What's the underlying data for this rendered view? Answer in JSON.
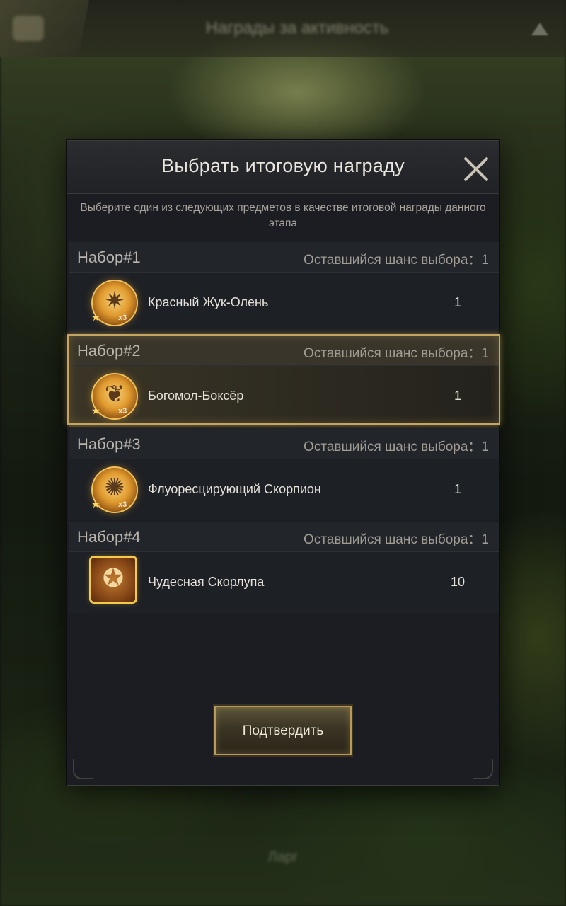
{
  "background": {
    "top_title": "Награды за активность",
    "bottom_text": "Ларг"
  },
  "modal": {
    "title": "Выбрать итоговую награду",
    "subtitle": "Выберите один из следующих предметов в качестве итоговой награды данного этапа",
    "confirm_label": "Подтвердить"
  },
  "sets": [
    {
      "name": "Набор#1",
      "chance_label": "Оставшийся шанс выбора：1",
      "item": {
        "name": "Красный Жук-Олень",
        "quantity": "1",
        "icon": "stag-beetle-icon",
        "badge": "x3"
      }
    },
    {
      "name": "Набор#2",
      "chance_label": "Оставшийся шанс выбора：1",
      "item": {
        "name": "Богомол-Боксёр",
        "quantity": "1",
        "icon": "mantis-icon",
        "badge": "x3"
      }
    },
    {
      "name": "Набор#3",
      "chance_label": "Оставшийся шанс выбора：1",
      "item": {
        "name": "Флуоресцирующий Скорпион",
        "quantity": "1",
        "icon": "scorpion-icon",
        "badge": "x3"
      }
    },
    {
      "name": "Набор#4",
      "chance_label": "Оставшийся шанс выбора：1",
      "item": {
        "name": "Чудесная Скорлупа",
        "quantity": "10",
        "icon": "shell-emblem-icon"
      }
    }
  ],
  "selected_set": 2,
  "colors": {
    "accent_gold": "#c6a560",
    "panel": "#1b1d22"
  }
}
